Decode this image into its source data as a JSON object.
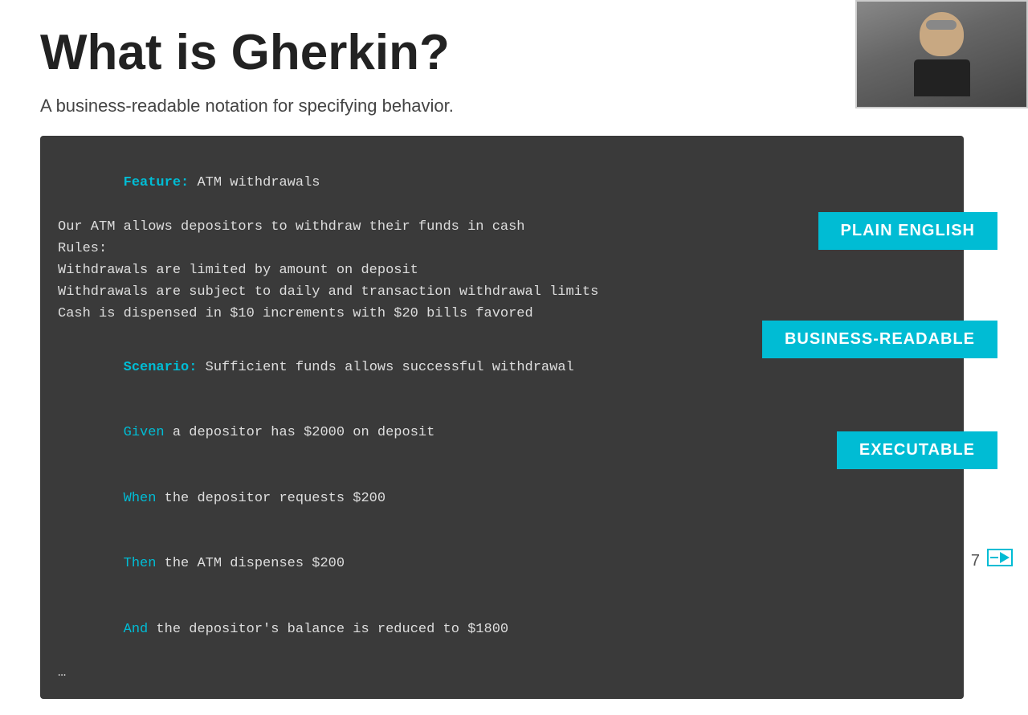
{
  "title": "What is Gherkin?",
  "subtitle": "A business-readable notation for specifying behavior.",
  "badges": {
    "plain_english": "PLAIN ENGLISH",
    "business_readable": "BUSINESS-READABLE",
    "executable": "EXECUTABLE"
  },
  "code": {
    "feature_keyword": "Feature:",
    "feature_text": " ATM withdrawals",
    "line2": "Our ATM allows depositors to withdraw their funds in cash",
    "line3": "Rules:",
    "line4": "Withdrawals are limited by amount on deposit",
    "line5": "Withdrawals are subject to daily and transaction withdrawal limits",
    "line6": "Cash is dispensed in $10 increments with $20 bills favored",
    "scenario_keyword": "Scenario:",
    "scenario_text": " Sufficient funds allows successful withdrawal",
    "given_keyword": "Given",
    "given_text": " a depositor has $2000 on deposit",
    "when_keyword": "When",
    "when_text": " the depositor requests $200",
    "then_keyword": "Then",
    "then_text": " the ATM dispenses $200",
    "and_keyword": "And",
    "and_text": " the depositor's balance is reduced to $1800",
    "ellipsis": "…"
  },
  "page_number": "7"
}
